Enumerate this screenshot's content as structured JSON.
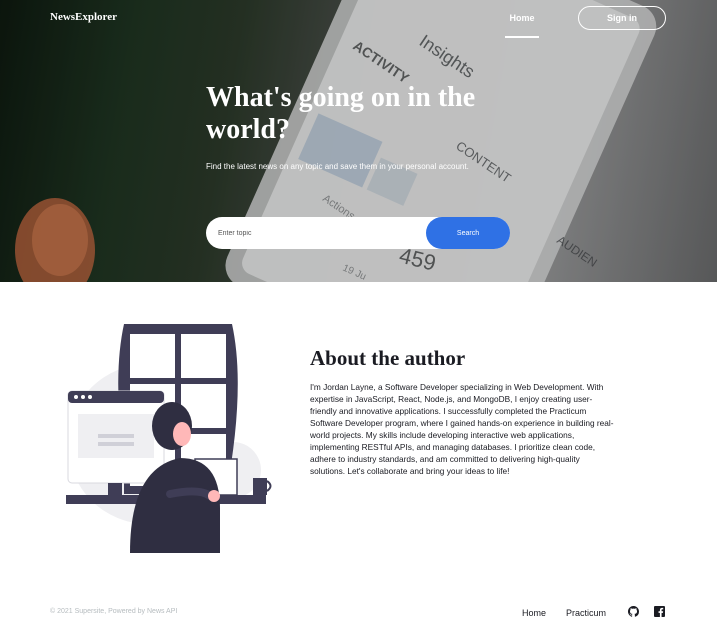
{
  "header": {
    "logo": "NewsExplorer",
    "nav_home": "Home",
    "signin_label": "Sign in"
  },
  "hero": {
    "title": "What's going on in the world?",
    "subtitle": "Find the latest news on any topic and save them in your personal account.",
    "search_placeholder": "Enter topic",
    "search_button": "Search",
    "background_words": [
      "Insights",
      "ACTIVITY",
      "CONTENT",
      "Actions",
      "AUDIEN",
      "459",
      "19 Ju"
    ]
  },
  "about": {
    "title": "About the author",
    "text": "I'm Jordan Layne, a Software Developer specializing in Web Development. With expertise in JavaScript, React, Node.js, and MongoDB, I enjoy creating user-friendly and innovative applications. I successfully completed the Practicum Software Developer program, where I gained hands-on experience in building real-world projects. My skills include developing interactive web applications, implementing RESTful APIs, and managing databases. I prioritize clean code, adhere to industry standards, and am committed to delivering high-quality solutions. Let's collaborate and bring your ideas to life!"
  },
  "footer": {
    "copyright": "© 2021 Supersite, Powered by News API",
    "home": "Home",
    "practicum": "Practicum",
    "icons": [
      "github-icon",
      "facebook-icon"
    ]
  },
  "colors": {
    "accent": "#2f71e5",
    "text": "#1a1b22",
    "muted": "#b6bcbf"
  }
}
